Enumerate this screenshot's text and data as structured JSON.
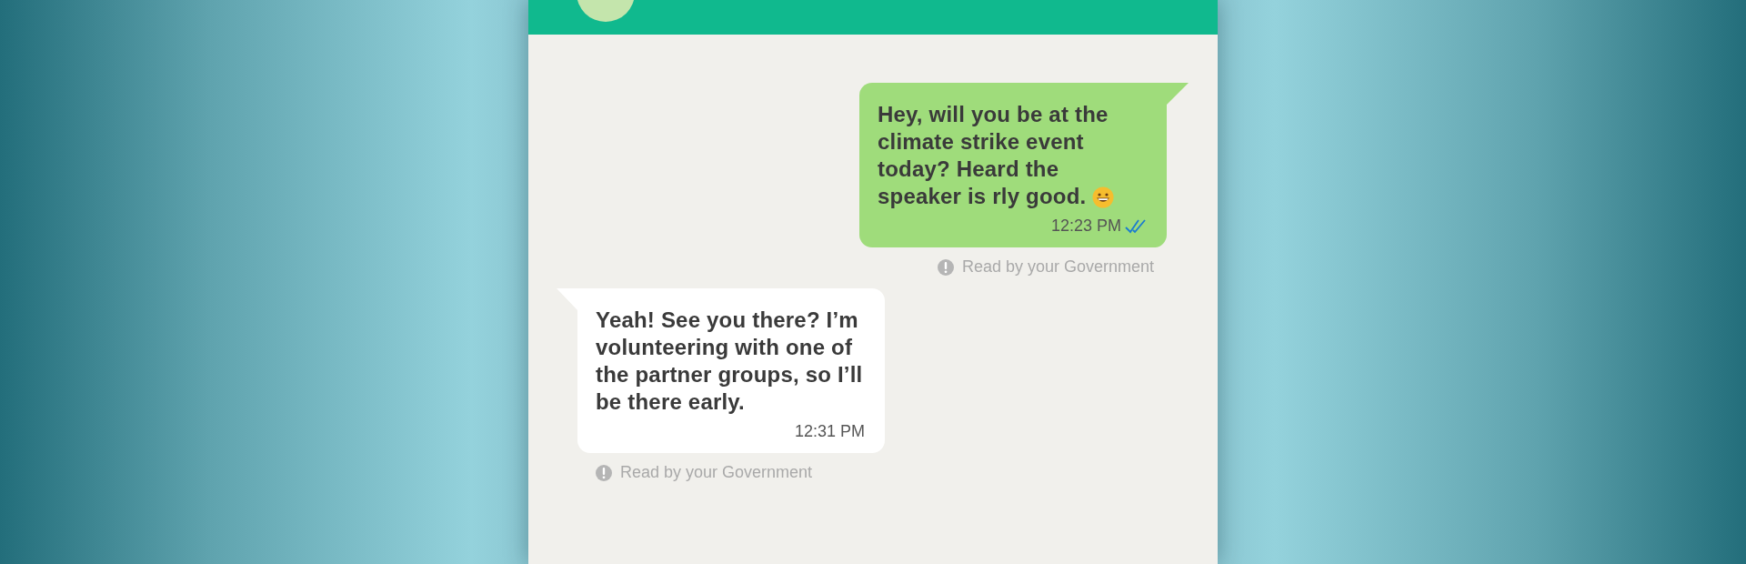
{
  "chat": {
    "messages": [
      {
        "kind": "outgoing",
        "text": "Hey, will you be at the climate strike event today? Heard the speaker is rly good.",
        "emoji": true,
        "time": "12:23 PM",
        "read": true,
        "notice": "Read by your Government"
      },
      {
        "kind": "incoming",
        "text": "Yeah! See you there? I’m volunteering with one of the partner groups, so I’ll be there early.",
        "emoji": false,
        "time": "12:31 PM",
        "read": false,
        "notice": "Read by your Government"
      }
    ]
  }
}
